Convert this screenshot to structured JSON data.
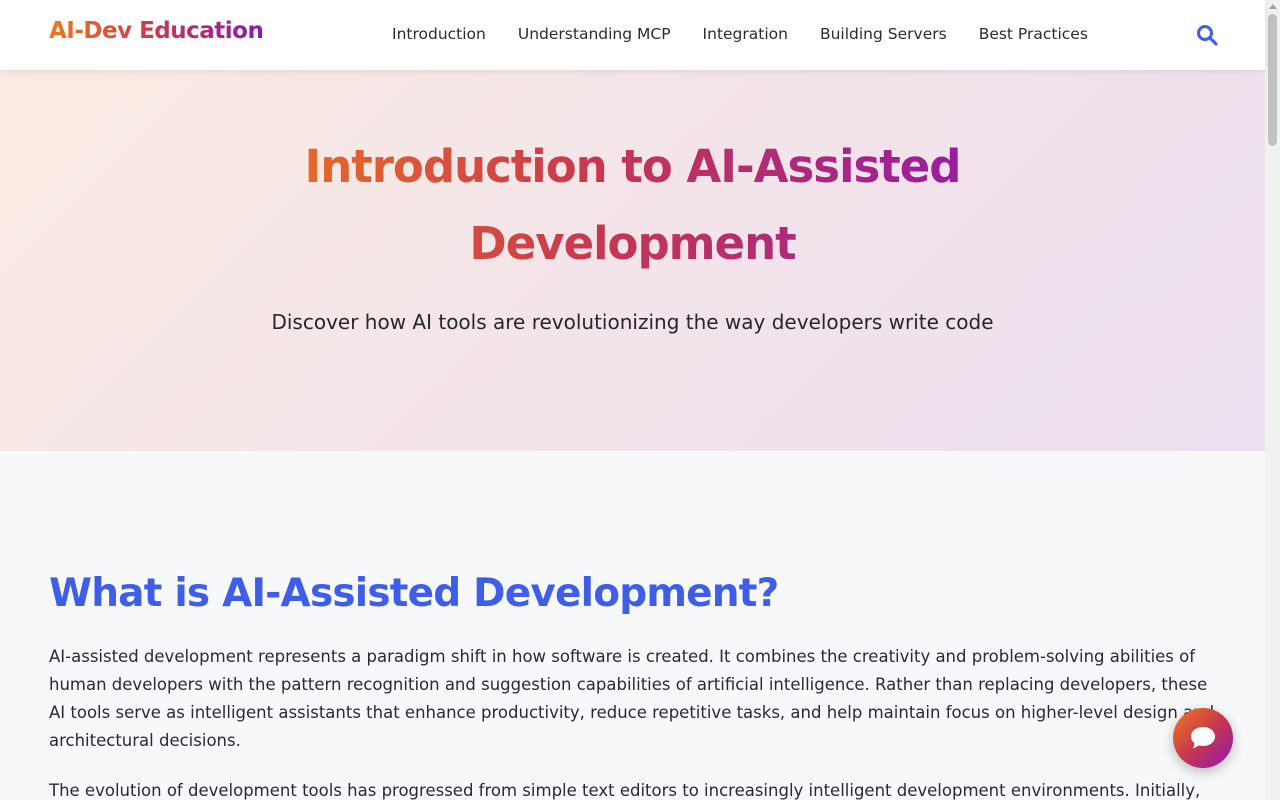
{
  "header": {
    "logo": "AI-Dev Education",
    "nav": [
      "Introduction",
      "Understanding MCP",
      "Integration",
      "Building Servers",
      "Best Practices"
    ],
    "search_icon": "search-icon"
  },
  "hero": {
    "title": "Introduction to AI-Assisted Development",
    "subtitle": "Discover how AI tools are revolutionizing the way developers write code"
  },
  "main": {
    "heading": "What is AI-Assisted Development?",
    "paragraphs": [
      "AI-assisted development represents a paradigm shift in how software is created. It combines the creativity and problem-solving abilities of human developers with the pattern recognition and suggestion capabilities of artificial intelligence. Rather than replacing developers, these AI tools serve as intelligent assistants that enhance productivity, reduce repetitive tasks, and help maintain focus on higher-level design and architectural decisions.",
      "The evolution of development tools has progressed from simple text editors to increasingly intelligent development environments. Initially,"
    ]
  },
  "chat_button": {
    "icon": "chat-bubble-icon"
  },
  "colors": {
    "accent_blue": "#3f5ee8",
    "gradient_orange": "#f07a1a",
    "gradient_red": "#c8384e",
    "gradient_purple": "#8c16b4"
  }
}
